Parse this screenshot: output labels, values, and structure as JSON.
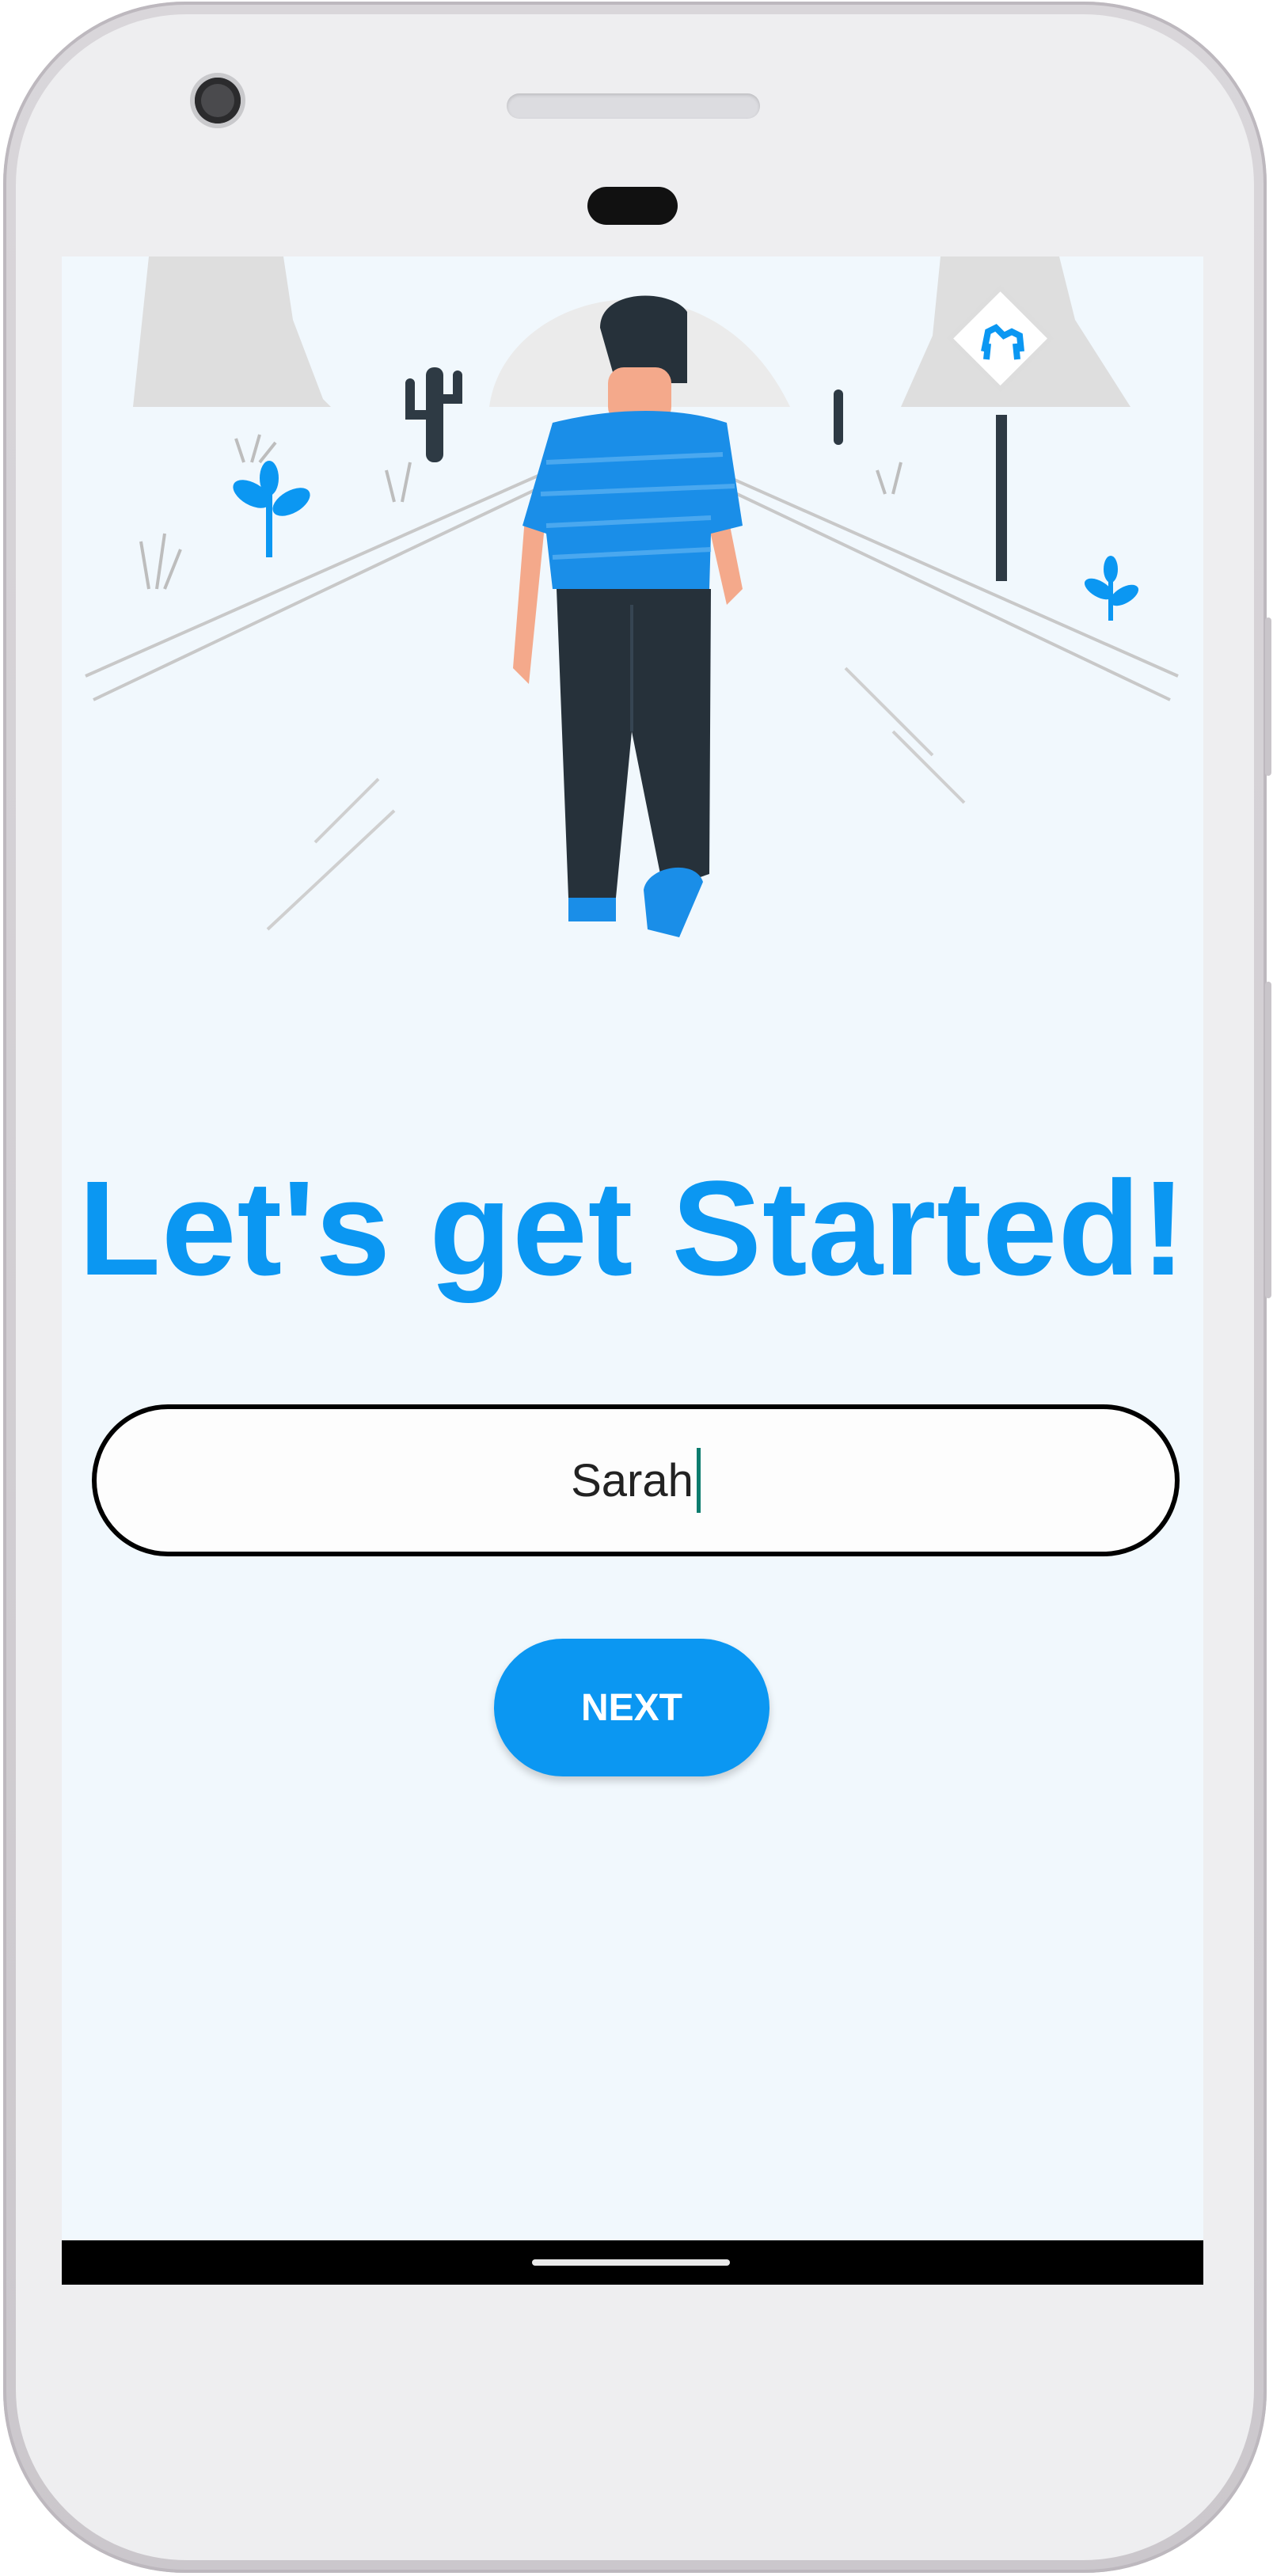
{
  "app": {
    "title": "Let's get Started!"
  },
  "form": {
    "name_value": "Sarah",
    "next_label": "NEXT"
  },
  "colors": {
    "accent": "#0b97f2",
    "screen_background": "#f1f8fd",
    "text_dark": "#222222"
  },
  "icons": {
    "illustration": "man-walking-on-road",
    "sign": "camel-crossing-sign"
  }
}
